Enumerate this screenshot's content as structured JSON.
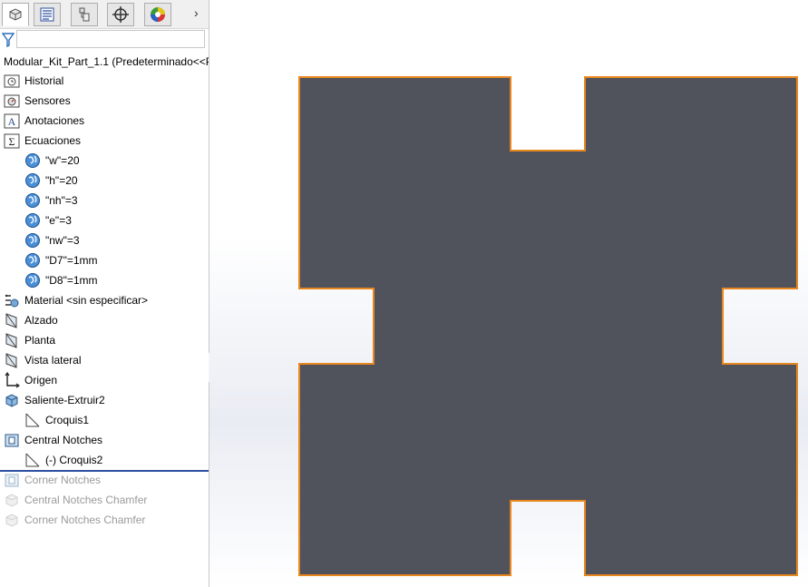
{
  "tabs": [
    {
      "name": "featuremanager-tab-icon",
      "active": true
    },
    {
      "name": "propertymanager-tab-icon",
      "active": false
    },
    {
      "name": "configurationmanager-tab-icon",
      "active": false
    },
    {
      "name": "dimxpert-tab-icon",
      "active": false
    },
    {
      "name": "display-manager-tab-icon",
      "active": false
    }
  ],
  "tab_more": "›",
  "filter": {
    "placeholder": ""
  },
  "tree": {
    "root": "Modular_Kit_Part_1.1  (Predeterminado<<P",
    "items": [
      {
        "label": "Historial",
        "icon": "history-folder-icon"
      },
      {
        "label": "Sensores",
        "icon": "sensors-folder-icon"
      },
      {
        "label": "Anotaciones",
        "icon": "annotations-folder-icon"
      },
      {
        "label": "Ecuaciones",
        "icon": "equations-folder-icon"
      },
      {
        "label": "\"w\"=20",
        "icon": "global-variable-icon"
      },
      {
        "label": "\"h\"=20",
        "icon": "global-variable-icon"
      },
      {
        "label": "\"nh\"=3",
        "icon": "global-variable-icon"
      },
      {
        "label": "\"e\"=3",
        "icon": "global-variable-icon"
      },
      {
        "label": "\"nw\"=3",
        "icon": "global-variable-icon"
      },
      {
        "label": "\"D7\"=1mm",
        "icon": "global-variable-icon"
      },
      {
        "label": "\"D8\"=1mm",
        "icon": "global-variable-icon"
      },
      {
        "label": "Material <sin especificar>",
        "icon": "material-icon"
      },
      {
        "label": "Alzado",
        "icon": "plane-icon"
      },
      {
        "label": "Planta",
        "icon": "plane-icon"
      },
      {
        "label": "Vista lateral",
        "icon": "plane-icon"
      },
      {
        "label": "Origen",
        "icon": "origin-icon"
      },
      {
        "label": "Saliente-Extruir2",
        "icon": "boss-extrude-icon"
      },
      {
        "label": "Croquis1",
        "icon": "sketch-icon"
      },
      {
        "label": "Central Notches",
        "icon": "cut-extrude-icon"
      },
      {
        "label": "(-) Croquis2",
        "icon": "sketch-icon"
      },
      {
        "label": "Corner Notches",
        "icon": "cut-extrude-icon"
      },
      {
        "label": "Central Notches Chamfer",
        "icon": "chamfer-icon"
      },
      {
        "label": "Corner Notches Chamfer",
        "icon": "chamfer-icon"
      }
    ]
  },
  "colors": {
    "part_face": "#50525c",
    "selection_edge": "#e8871e",
    "rollback_bar": "#2b4f9e",
    "suppressed_text": "#9a9a9a"
  }
}
